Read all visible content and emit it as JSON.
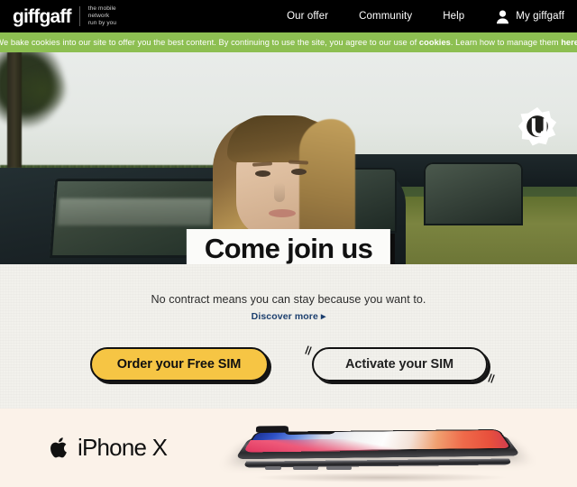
{
  "header": {
    "brand_word": "giffgaff",
    "brand_tagline": "the mobile\nnetwork\nrun by you",
    "nav": [
      {
        "label": "Our offer",
        "name": "nav-our-offer"
      },
      {
        "label": "Community",
        "name": "nav-community"
      },
      {
        "label": "Help",
        "name": "nav-help"
      }
    ],
    "account_label": "My giffgaff",
    "account_icon": "user-avatar-icon",
    "background": "#000000"
  },
  "cookie_banner": {
    "text_before": "We bake cookies into our site to offer you the best content. By continuing to use the site, you agree to our use of ",
    "link_cookies": "cookies",
    "text_middle": ". Learn how to manage them ",
    "link_here": "here",
    "text_after": ".",
    "background": "#8dbf52"
  },
  "hero": {
    "headline": "Come join us",
    "badge_letter": "U",
    "badge_name": "starburst-u-badge"
  },
  "promo": {
    "tagline": "No contract means you can stay because you want to.",
    "discover_link": "Discover more ▸",
    "primary_button": "Order your Free SIM",
    "secondary_button": "Activate your SIM",
    "primary_color": "#f6c544"
  },
  "iphone_section": {
    "apple_glyph": "",
    "product_name": "iPhone X",
    "background": "#fbf2e9"
  }
}
